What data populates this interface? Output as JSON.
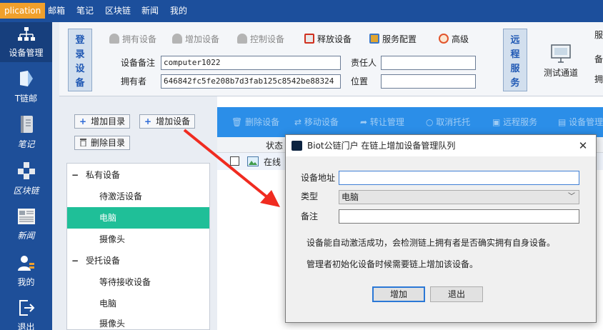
{
  "topbar": {
    "app_label": "plication",
    "menu": [
      "邮箱",
      "笔记",
      "区块链",
      "新闻",
      "我的"
    ]
  },
  "leftnav": {
    "items": [
      {
        "label": "设备管理",
        "icon": "device-network-icon"
      },
      {
        "label": "T链邮",
        "icon": "mail-icon"
      },
      {
        "label": "笔记",
        "icon": "notebook-icon"
      },
      {
        "label": "区块链",
        "icon": "blockchain-cubes-icon"
      },
      {
        "label": "新闻",
        "icon": "news-icon"
      },
      {
        "label": "我的",
        "icon": "user-icon"
      },
      {
        "label": "退出",
        "icon": "logout-icon"
      }
    ]
  },
  "device_panel": {
    "section_title": "登录设备",
    "tools": [
      "拥有设备",
      "增加设备",
      "控制设备",
      "释放设备",
      "服务配置",
      "高级"
    ],
    "note_label": "设备备注",
    "note_value": "computer1022",
    "owner_label": "拥有者",
    "owner_value": "646842fc5fe208b7d3fab125c8542be88324",
    "responsible_label": "责任人",
    "responsible_value": "",
    "location_label": "位置",
    "location_value": "",
    "remote_title": "远程服务",
    "test_channel_label": "测试通道",
    "right_cut": [
      "服",
      "备",
      "拥"
    ]
  },
  "left_panel": {
    "add_dir_label": "增加目录",
    "add_device_label": "增加设备",
    "delete_dir_label": "删除目录",
    "tree": [
      {
        "label": "私有设备",
        "level": 0
      },
      {
        "label": "待激活设备",
        "level": 1
      },
      {
        "label": "电脑",
        "level": 1,
        "selected": true
      },
      {
        "label": "摄像头",
        "level": 1
      },
      {
        "label": "受托设备",
        "level": 0
      },
      {
        "label": "等待接收设备",
        "level": 1
      },
      {
        "label": "电脑",
        "level": 1
      },
      {
        "label": "摄像头",
        "level": 1
      }
    ]
  },
  "device_list": {
    "toolbar": [
      "删除设备",
      "移动设备",
      "转让管理",
      "取消托托",
      "远程服务",
      "设备管理"
    ],
    "header_status": "状态",
    "row_status": "在线"
  },
  "dialog": {
    "title": "Biot公链门户 在链上增加设备管理队列",
    "address_label": "设备地址",
    "address_value": "",
    "type_label": "类型",
    "type_value": "电脑",
    "note_label": "备注",
    "note_value": "",
    "hint1": "设备能自动激活成功，会检测链上拥有者是否确实拥有自身设备。",
    "hint2": "管理者初始化设备时候需要链上增加该设备。",
    "add_label": "增加",
    "exit_label": "退出",
    "close_label": "✕"
  },
  "colors": {
    "topbar": "#1c4f9c",
    "app_label": "#f0a02c",
    "selected_row": "#1fbf98",
    "list_toolbar": "#2b8ee8",
    "arrow": "#f02b20"
  }
}
